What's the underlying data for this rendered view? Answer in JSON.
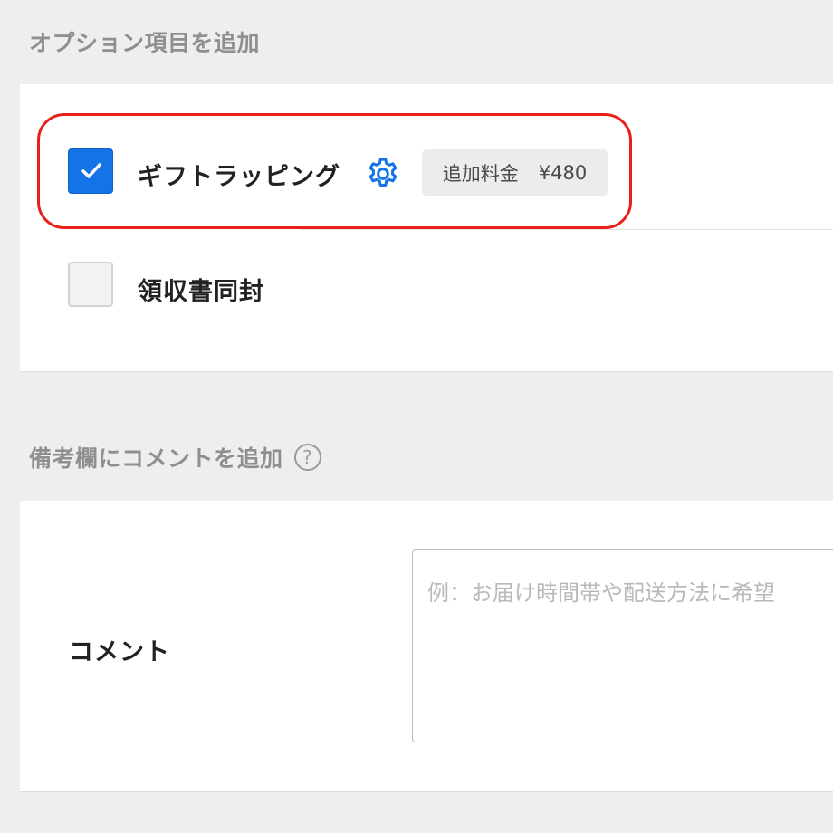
{
  "options_section": {
    "title": "オプション項目を追加",
    "items": [
      {
        "label": "ギフトラッピング",
        "checked": true,
        "settings_icon": "gear-icon",
        "fee_label": "追加料金",
        "fee_value": "¥480"
      },
      {
        "label": "領収書同封",
        "checked": false
      }
    ]
  },
  "comment_section": {
    "title": "備考欄にコメントを追加",
    "help_icon": "?",
    "field_label": "コメント",
    "placeholder": "例：お届け時間帯や配送方法に希望"
  },
  "colors": {
    "accent": "#1473e6",
    "highlight": "#e8201a"
  }
}
